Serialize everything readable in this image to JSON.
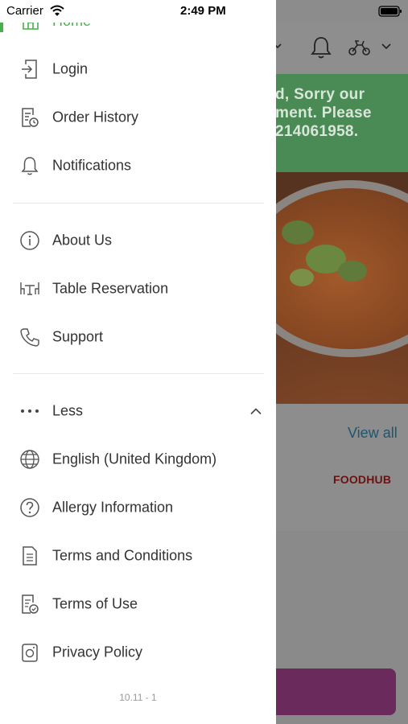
{
  "status_bar": {
    "carrier": "Carrier",
    "time": "2:49 PM"
  },
  "background": {
    "banner_text": "d, Sorry our\nment. Please\n214061958.",
    "view_all": "View all",
    "logo_text": "FOODHUB",
    "banner_color": "#4a8a55",
    "cta_color": "#6b2a5c"
  },
  "drawer": {
    "home_label": "Home",
    "accent": "#47b04c",
    "section1": [
      {
        "label": "Login",
        "icon": "login-icon"
      },
      {
        "label": "Order History",
        "icon": "order-history-icon"
      },
      {
        "label": "Notifications",
        "icon": "bell-icon"
      }
    ],
    "section2": [
      {
        "label": "About Us",
        "icon": "info-icon"
      },
      {
        "label": "Table Reservation",
        "icon": "table-icon"
      },
      {
        "label": "Support",
        "icon": "phone-icon"
      }
    ],
    "less_label": "Less",
    "section3": [
      {
        "label": "English (United Kingdom)",
        "icon": "globe-icon"
      },
      {
        "label": "Allergy Information",
        "icon": "question-icon"
      },
      {
        "label": "Terms and Conditions",
        "icon": "document-icon"
      },
      {
        "label": "Terms of Use",
        "icon": "document-check-icon"
      },
      {
        "label": "Privacy Policy",
        "icon": "privacy-icon"
      }
    ],
    "version": "10.11 - 1"
  }
}
